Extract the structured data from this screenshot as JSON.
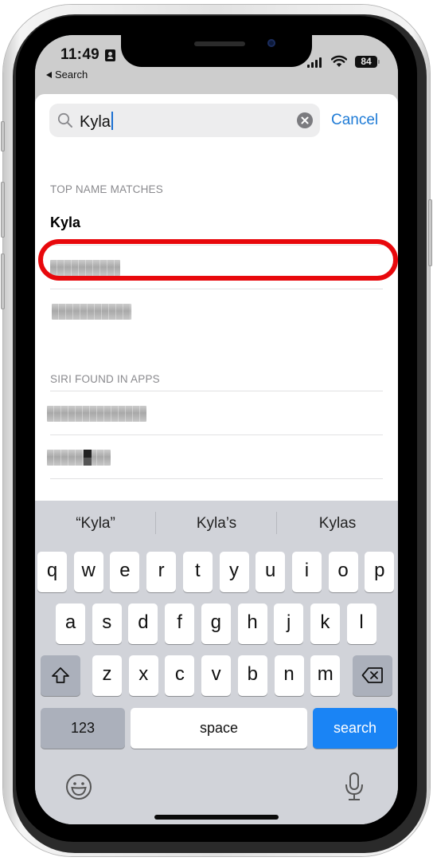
{
  "status_bar": {
    "time": "11:49",
    "back_app_label": "Search",
    "battery_level": "84",
    "icons": [
      "contact-card-icon",
      "cellular-signal-icon",
      "wifi-icon",
      "battery-icon"
    ]
  },
  "search": {
    "query": "Kyla",
    "clear_icon": "clear-circle-icon",
    "cancel_label": "Cancel"
  },
  "sections": {
    "top_name_matches": {
      "header": "TOP NAME MATCHES",
      "items": [
        {
          "label": "Kyla",
          "highlighted": true,
          "highlight_color": "#e8080c"
        },
        {
          "label": "",
          "redacted": true
        },
        {
          "label": "",
          "redacted": true
        }
      ]
    },
    "siri_found_in_apps": {
      "header": "SIRI FOUND IN APPS",
      "items": [
        {
          "label": "",
          "redacted": true
        },
        {
          "label": "",
          "redacted": true
        }
      ]
    }
  },
  "keyboard": {
    "suggestions": [
      "“Kyla”",
      "Kyla’s",
      "Kylas"
    ],
    "row1": [
      "q",
      "w",
      "e",
      "r",
      "t",
      "y",
      "u",
      "i",
      "o",
      "p"
    ],
    "row2": [
      "a",
      "s",
      "d",
      "f",
      "g",
      "h",
      "j",
      "k",
      "l"
    ],
    "row3": [
      "z",
      "x",
      "c",
      "v",
      "b",
      "n",
      "m"
    ],
    "shift_icon": "shift-icon",
    "delete_icon": "delete-icon",
    "numbers_label": "123",
    "space_label": "space",
    "search_label": "search",
    "emoji_icon": "emoji-icon",
    "dictation_icon": "microphone-icon"
  },
  "colors": {
    "accent": "#1e7bd6",
    "search_key": "#1a84f5",
    "highlight": "#e8080c"
  }
}
